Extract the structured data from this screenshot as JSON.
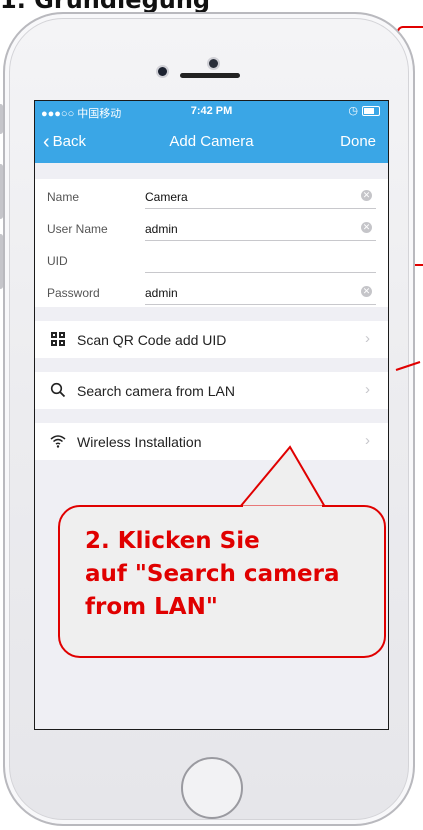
{
  "heading_partial": "1. Grundlegung",
  "statusbar": {
    "carrier": "●●●○○ 中国移动",
    "time": "7:42 PM"
  },
  "navbar": {
    "back": "Back",
    "title": "Add Camera",
    "done": "Done"
  },
  "form": {
    "name_label": "Name",
    "name_value": "Camera",
    "username_label": "User Name",
    "username_value": "admin",
    "uid_label": "UID",
    "uid_value": "",
    "password_label": "Password",
    "password_value": "admin"
  },
  "menu": [
    {
      "label": "Scan QR Code add UID",
      "icon": "qr-code-icon"
    },
    {
      "label": "Search camera from LAN",
      "icon": "search-icon"
    },
    {
      "label": "Wireless Installation",
      "icon": "wifi-icon"
    }
  ],
  "callout": {
    "line1": "2. Klicken Sie",
    "line2": "auf \"Search camera",
    "line3": "from LAN\""
  },
  "colors": {
    "accent": "#3aa6e6",
    "annotation": "#e00000"
  }
}
